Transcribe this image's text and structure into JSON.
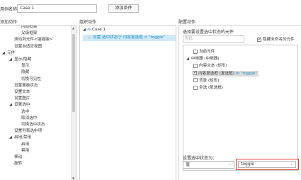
{
  "top": {
    "case_label": "用例名称",
    "case_value": "Case 1",
    "add_condition": "添加条件"
  },
  "headers": {
    "add_action": "添加动作",
    "organize_action": "组织动作",
    "configure_action": "配置动作"
  },
  "left_tree": [
    {
      "text": "内部框架",
      "indent": 2,
      "arrow": ""
    },
    {
      "text": "父级框架",
      "indent": 2,
      "arrow": ""
    },
    {
      "text": "滚动到元件<锚链接>",
      "indent": 1,
      "arrow": ""
    },
    {
      "text": "设置自适应视图",
      "indent": 1,
      "arrow": ""
    },
    {
      "text": "元件",
      "indent": 0,
      "arrow": "◢"
    },
    {
      "text": "显示/隐藏",
      "indent": 1,
      "arrow": "◢"
    },
    {
      "text": "显示",
      "indent": 2,
      "arrow": ""
    },
    {
      "text": "隐藏",
      "indent": 2,
      "arrow": ""
    },
    {
      "text": "切换可见性",
      "indent": 2,
      "arrow": ""
    },
    {
      "text": "设置面板状态",
      "indent": 1,
      "arrow": ""
    },
    {
      "text": "设置文本",
      "indent": 1,
      "arrow": ""
    },
    {
      "text": "设置图片",
      "indent": 1,
      "arrow": ""
    },
    {
      "text": "设置选中",
      "indent": 1,
      "arrow": "◢"
    },
    {
      "text": "选中",
      "indent": 2,
      "arrow": ""
    },
    {
      "text": "取消选中",
      "indent": 2,
      "arrow": ""
    },
    {
      "text": "切换选中状态",
      "indent": 2,
      "arrow": ""
    },
    {
      "text": "设置列表选中项",
      "indent": 1,
      "arrow": ""
    },
    {
      "text": "启用/禁用",
      "indent": 1,
      "arrow": "◢"
    },
    {
      "text": "启用",
      "indent": 2,
      "arrow": ""
    },
    {
      "text": "禁用",
      "indent": 2,
      "arrow": ""
    },
    {
      "text": "移动",
      "indent": 1,
      "arrow": ""
    },
    {
      "text": "旋转",
      "indent": 1,
      "arrow": ""
    }
  ],
  "middle": {
    "case_name": "Case 1",
    "action_text": "设置 选中状态于 内容复选框 = \"toggle\""
  },
  "right": {
    "select_label": "选择要设置选中状态的元件",
    "filter_placeholder": "查找",
    "hide_unnamed": "隐藏未命名的元件",
    "elements": [
      {
        "label": "当前元件",
        "checked": false,
        "indent": 1,
        "arrow": ""
      },
      {
        "label": "中继器 (中继器)",
        "checked": null,
        "indent": 0,
        "arrow": "◢"
      },
      {
        "label": "内容文本 (矩形)",
        "checked": false,
        "indent": 1,
        "arrow": ""
      },
      {
        "label": "内容复选框 (复选框) ",
        "value": "to \"toggle\"",
        "checked": true,
        "indent": 1,
        "arrow": "",
        "selected": true
      },
      {
        "label": "背景 (矩形)",
        "checked": false,
        "indent": 1,
        "arrow": ""
      },
      {
        "label": "全选 (复选框)",
        "checked": false,
        "indent": 1,
        "arrow": ""
      }
    ],
    "state_label": "设置选中状态为：",
    "state_type": "值",
    "state_value": "toggle"
  },
  "colors": {
    "accent_blue": "#1a8cc4",
    "selection_bg": "#cfe9fa",
    "highlight_red": "#e53935"
  }
}
